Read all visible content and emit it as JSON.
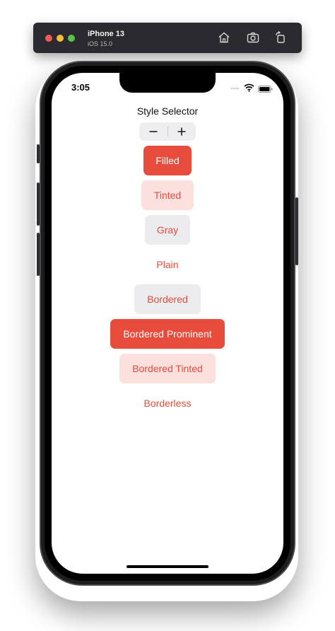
{
  "simulator": {
    "device_name": "iPhone 13",
    "os_version": "iOS 15.0",
    "icons": [
      "home-icon",
      "screenshot-icon",
      "rotate-icon"
    ]
  },
  "status_bar": {
    "time": "3:05",
    "icons": [
      "cellular-dots-icon",
      "wifi-icon",
      "battery-icon"
    ]
  },
  "screen": {
    "title": "Style Selector",
    "stepper": {
      "decrement_icon": "minus-icon",
      "increment_icon": "plus-icon"
    },
    "buttons": [
      {
        "label": "Filled",
        "style": "filled"
      },
      {
        "label": "Tinted",
        "style": "tinted"
      },
      {
        "label": "Gray",
        "style": "gray"
      },
      {
        "label": "Plain",
        "style": "plain"
      },
      {
        "label": "Bordered",
        "style": "bordered"
      },
      {
        "label": "Bordered Prominent",
        "style": "borderedProminent"
      },
      {
        "label": "Bordered Tinted",
        "style": "borderedTinted"
      },
      {
        "label": "Borderless",
        "style": "borderless"
      }
    ]
  },
  "colors": {
    "accent": "#e74c3c",
    "tint_background": "#fbe0de",
    "gray_background": "#ececee",
    "toolbar": "#2b2a2e"
  }
}
